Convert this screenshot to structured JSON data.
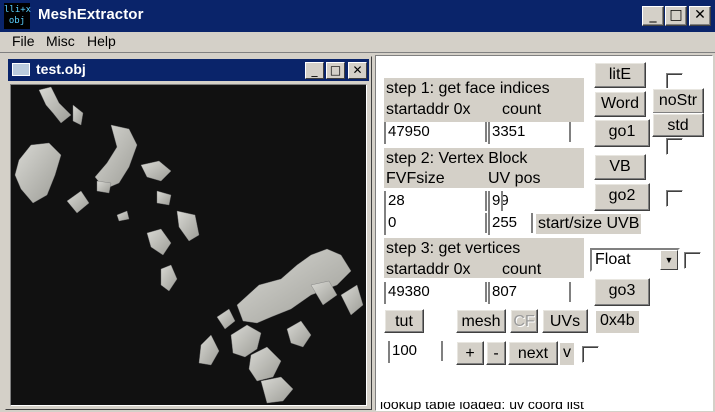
{
  "app": {
    "icon_text": "lli+x obj",
    "title": "MeshExtractor",
    "min_glyph": "_",
    "max_glyph": "□",
    "close_glyph": "✕"
  },
  "menu": [
    "File",
    "Misc",
    "Help"
  ],
  "child": {
    "title": "test.obj",
    "min_glyph": "_",
    "max_glyph": "□",
    "close_glyph": "✕"
  },
  "panel": {
    "step1": {
      "title": "step 1: get face indices",
      "addr_label": "startaddr 0x",
      "count_label": "count",
      "addr_value": "47950",
      "count_value": "3351"
    },
    "step2": {
      "title": "step 2: Vertex Block",
      "fvf_label": "FVFsize",
      "uv_label": "UV pos",
      "fvf_value": "28",
      "uv_value": "99",
      "start_value": "0",
      "size_value": "255",
      "startsize_label": "start/size UVB"
    },
    "step3": {
      "title": "step 3: get vertices",
      "addr_label": "startaddr 0x",
      "count_label": "count",
      "addr_value": "49380",
      "count_value": "807"
    },
    "buttons": {
      "lite": "litE",
      "word": "Word",
      "nostr": "noStr",
      "std": "std",
      "go1": "go1",
      "vb": "VB",
      "go2": "go2",
      "go3": "go3",
      "tut": "tut",
      "mesh": "mesh",
      "cf": "CF",
      "uvs": "UVs",
      "plus": "+",
      "minus": "-",
      "next": "next"
    },
    "format_select": "Float",
    "hex_label": "0x4b",
    "step_value": "100",
    "v_label": "v",
    "footer_text": "lookup table loaded: uv coord list"
  }
}
